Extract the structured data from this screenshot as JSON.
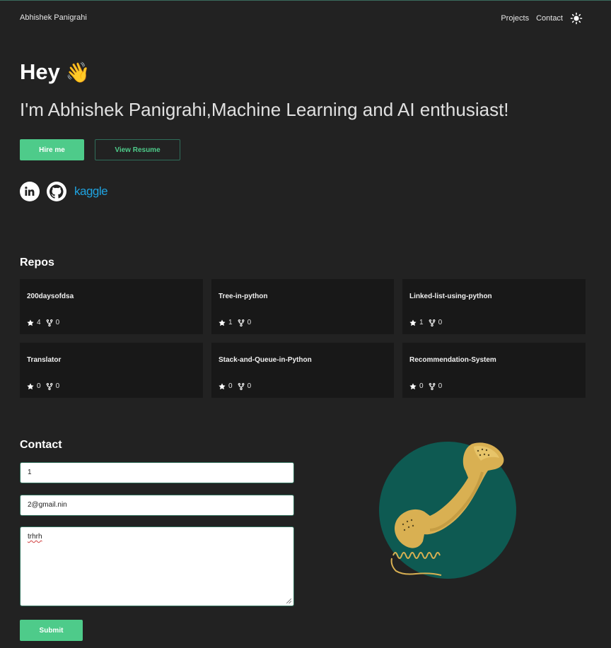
{
  "header": {
    "brand": "Abhishek Panigrahi",
    "nav": [
      "Projects",
      "Contact"
    ],
    "theme_icon": "sun-icon"
  },
  "hero": {
    "greeting": "Hey",
    "greeting_emoji": "👋",
    "tagline": "I'm Abhishek Panigrahi,Machine Learning and AI enthusiast!",
    "hire_label": "Hire me",
    "resume_label": "View Resume"
  },
  "socials": {
    "linkedin_icon": "linkedin-icon",
    "github_icon": "github-icon",
    "kaggle_label": "kaggle"
  },
  "repos": {
    "title": "Repos",
    "items": [
      {
        "name": "200daysofdsa",
        "stars": "4",
        "forks": "0"
      },
      {
        "name": "Tree-in-python",
        "stars": "1",
        "forks": "0"
      },
      {
        "name": "Linked-list-using-python",
        "stars": "1",
        "forks": "0"
      },
      {
        "name": "Translator",
        "stars": "0",
        "forks": "0"
      },
      {
        "name": "Stack-and-Queue-in-Python",
        "stars": "0",
        "forks": "0"
      },
      {
        "name": "Recommendation-System",
        "stars": "0",
        "forks": "0"
      }
    ]
  },
  "contact": {
    "title": "Contact",
    "name_value": "1",
    "email_value": "2@gmail.nin",
    "message_value": "trhrh",
    "submit_label": "Submit",
    "illustration": "telephone-illustration"
  },
  "colors": {
    "background": "#222222",
    "accent": "#4ecb8a",
    "card": "#181818",
    "circle": "#0e5a52",
    "phone": "#d9b052"
  }
}
